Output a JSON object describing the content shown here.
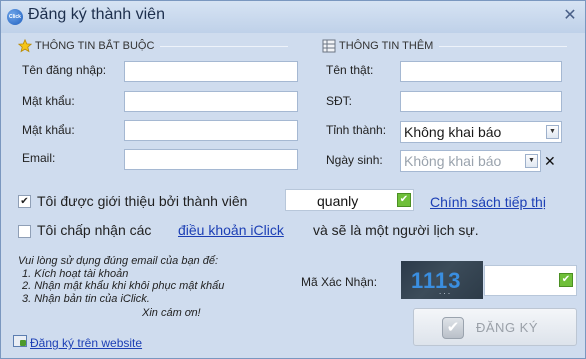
{
  "window": {
    "title": "Đăng ký thành viên",
    "icon_text": "Click",
    "close_glyph": "✕"
  },
  "sections": {
    "required_title": "THÔNG TIN BẮT BUỘC",
    "extra_title": "THÔNG TIN THÊM"
  },
  "required_fields": {
    "username_label": "Tên đăng nhập:",
    "password_label": "Mật khẩu:",
    "confirm_password_label": "Mật khẩu:",
    "email_label": "Email:"
  },
  "extra_fields": {
    "fullname_label": "Tên thật:",
    "phone_label": "SĐT:",
    "province_label": "Tỉnh thành:",
    "province_value": "Không khai báo",
    "dob_label": "Ngày sinh:",
    "dob_value": "Không khai báo",
    "dob_clear_glyph": "✕"
  },
  "referral": {
    "checked": true,
    "label": "Tôi được giới thiệu bởi thành viên",
    "value": "quanly",
    "policy_link": "Chính sách tiếp thị"
  },
  "terms": {
    "checked": false,
    "prefix": "Tôi chấp nhận các",
    "link": "điều khoản iClick",
    "suffix": "và sẽ là một người lịch sự."
  },
  "note": {
    "intro": "Vui lòng sử dụng đúng email của bạn để:",
    "items": [
      "1. Kích hoạt tài khoản",
      "2. Nhận mật khẩu khi khôi phục mật khẩu",
      "3. Nhận bản tin của iClick."
    ],
    "thanks": "Xin cám ơn!"
  },
  "captcha": {
    "label": "Mã Xác Nhận:",
    "code": "1113",
    "noise": ". . ."
  },
  "register_button": {
    "label": "ĐĂNG KÝ",
    "enabled": false
  },
  "web_register_link": "Đăng ký trên website",
  "colors": {
    "accent_link": "#1c3fb5",
    "ok_green": "#6fbf39",
    "window_bg": "#cfdcee"
  },
  "icons": {
    "app": "iclick-logo-icon",
    "required_section": "star-icon",
    "extra_section": "grid-icon",
    "register": "check-icon",
    "web": "browser-icon"
  }
}
